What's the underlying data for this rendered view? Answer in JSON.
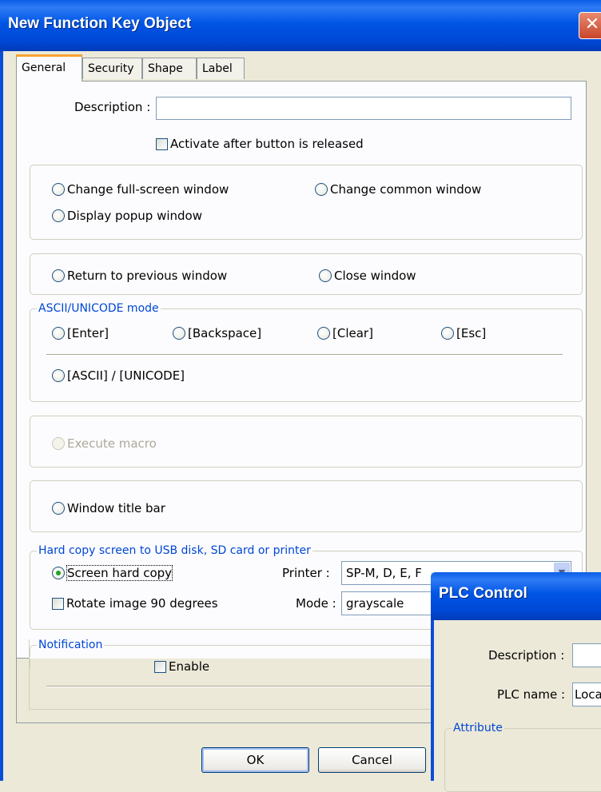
{
  "window": {
    "title": "New  Function Key Object",
    "close_glyph": "✕"
  },
  "tabs": [
    "General",
    "Security",
    "Shape",
    "Label"
  ],
  "general": {
    "description_label": "Description :",
    "description_value": "",
    "activate_after_release": {
      "label": "Activate after button is released",
      "checked": false
    }
  },
  "window_ops": {
    "change_fullscreen": "Change full-screen window",
    "change_common": "Change common window",
    "display_popup": "Display popup window",
    "return_previous": "Return to previous window",
    "close_window": "Close window"
  },
  "ascii": {
    "legend": "ASCII/UNICODE mode",
    "enter": "[Enter]",
    "backspace": "[Backspace]",
    "clear": "[Clear]",
    "esc": "[Esc]",
    "ascii_unicode": "[ASCII] / [UNICODE]"
  },
  "macro": {
    "label": "Execute macro",
    "disabled": true
  },
  "titlebar_option": {
    "label": "Window title bar"
  },
  "hardcopy": {
    "legend": "Hard copy screen to USB disk, SD card or printer",
    "screen_hard_copy": {
      "label": "Screen hard copy",
      "selected": true
    },
    "rotate": {
      "label": "Rotate image 90 degrees",
      "checked": false
    },
    "printer_label": "Printer :",
    "printer_value": "SP-M, D, E, F",
    "mode_label": "Mode :",
    "mode_value": "grayscale"
  },
  "notification": {
    "legend": "Notification",
    "enable_label": "Enable",
    "enabled": false
  },
  "buttons": {
    "ok": "OK",
    "cancel": "Cancel"
  },
  "plc": {
    "title": "PLC Control",
    "description_label": "Description :",
    "plc_name_label": "PLC name :",
    "plc_name_value": "Loca",
    "attribute_legend": "Attribute"
  },
  "colors": {
    "titlebar": "#0055e5",
    "legend_text": "#0046d5",
    "panel_bg": "#fcfcfe",
    "window_bg": "#ece9d8"
  }
}
